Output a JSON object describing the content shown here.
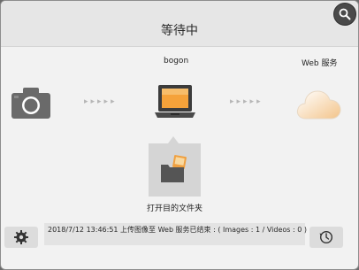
{
  "window": {
    "title": "等待中"
  },
  "devices": {
    "camera": {
      "icon": "camera-icon"
    },
    "computer": {
      "label": "bogon",
      "icon": "laptop-icon"
    },
    "web": {
      "label": "Web 服务",
      "icon": "cloud-icon"
    }
  },
  "transfer": {
    "arrows_left": "▸▸▸▸▸",
    "arrows_right": "▸▸▸▸▸"
  },
  "folder": {
    "label": "打开目的文件夹",
    "icon": "photo-folder-icon"
  },
  "status": {
    "text": "2018/7/12 13:46:51   上传图像至 Web 服务已结束 : ( Images : 1 / Videos : 0 )"
  },
  "buttons": {
    "settings_icon": "gear-icon",
    "history_icon": "clock-icon",
    "zoom_icon": "magnifier-icon"
  },
  "colors": {
    "cloud_gradient_start": "#ffffff",
    "cloud_gradient_end": "#f3c48a",
    "photo_accent": "#f0a040"
  }
}
